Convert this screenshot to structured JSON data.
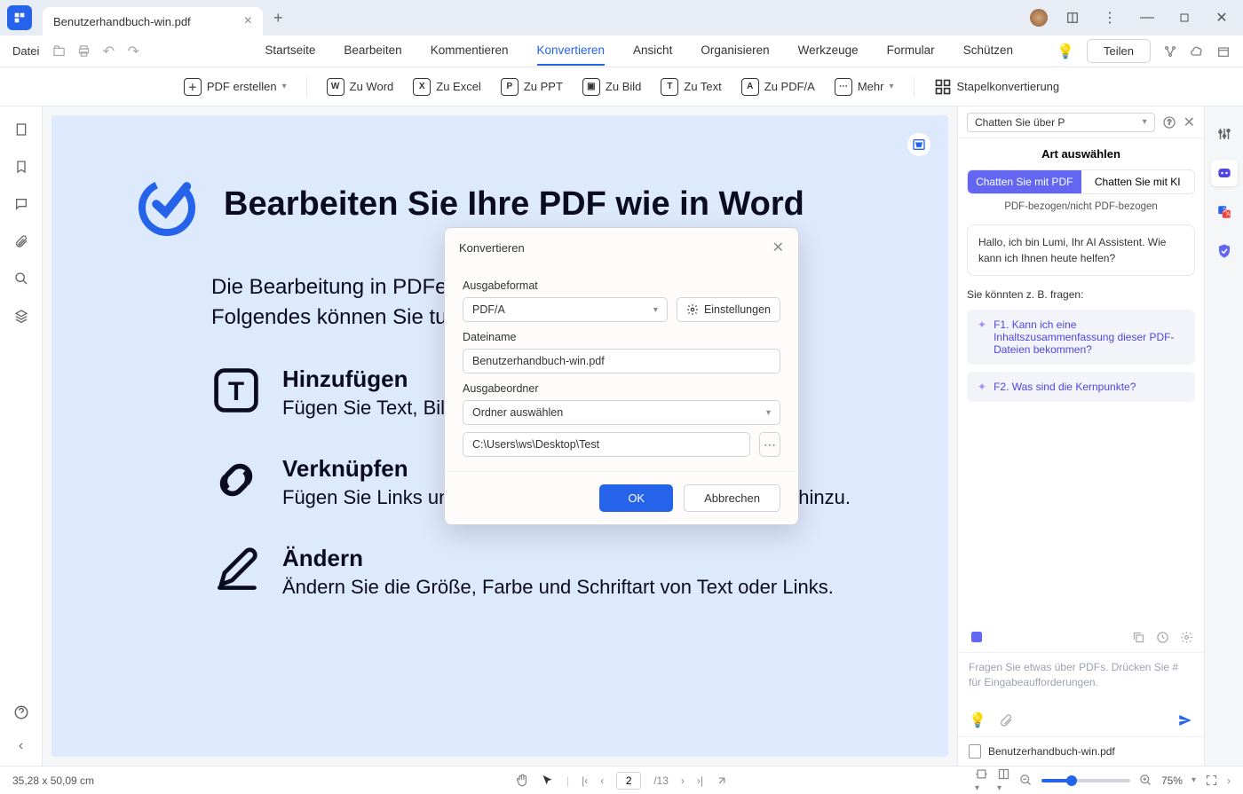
{
  "tab": {
    "title": "Benutzerhandbuch-win.pdf"
  },
  "menu": {
    "file": "Datei",
    "items": [
      "Startseite",
      "Bearbeiten",
      "Kommentieren",
      "Konvertieren",
      "Ansicht",
      "Organisieren",
      "Werkzeuge",
      "Formular",
      "Schützen"
    ],
    "active_index": 3,
    "share": "Teilen"
  },
  "toolbar": {
    "create": "PDF erstellen",
    "word": "Zu Word",
    "excel": "Zu Excel",
    "ppt": "Zu PPT",
    "image": "Zu Bild",
    "text": "Zu Text",
    "pdfa": "Zu PDF/A",
    "more": "Mehr",
    "batch": "Stapelkonvertierung"
  },
  "document": {
    "title": "Bearbeiten Sie Ihre PDF wie in Word",
    "intro1": "Die Bearbeitung in PDFele",
    "intro2": "Folgendes können Sie tu",
    "sections": [
      {
        "title": "Hinzufügen",
        "desc": "Fügen Sie Text, Bilder"
      },
      {
        "title": "Verknüpfen",
        "desc": "Fügen Sie Links und Wasserzeichen zu Ihren PDF-Dateien hinzu."
      },
      {
        "title": "Ändern",
        "desc": "Ändern Sie die Größe, Farbe und Schriftart von Text oder Links."
      }
    ]
  },
  "dialog": {
    "title": "Konvertieren",
    "format_label": "Ausgabeformat",
    "format_value": "PDF/A",
    "settings": "Einstellungen",
    "filename_label": "Dateiname",
    "filename_value": "Benutzerhandbuch-win.pdf",
    "folder_label": "Ausgabeordner",
    "folder_select": "Ordner auswählen",
    "folder_path": "C:\\Users\\ws\\Desktop\\Test",
    "ok": "OK",
    "cancel": "Abbrechen"
  },
  "chat": {
    "selector": "Chatten Sie über P",
    "title": "Art auswählen",
    "tab_pdf": "Chatten Sie mit PDF",
    "tab_ai": "Chatten Sie mit KI",
    "subtext": "PDF-bezogen/nicht PDF-bezogen",
    "greeting": "Hallo, ich bin Lumi, Ihr AI Assistent. Wie kann ich Ihnen heute helfen?",
    "suggest_title": "Sie könnten z. B. fragen:",
    "suggestions": [
      "F1. Kann ich eine Inhaltszusammenfassung dieser PDF-Dateien bekommen?",
      "F2. Was sind die Kernpunkte?"
    ],
    "placeholder": "Fragen Sie etwas über PDFs. Drücken Sie # für Eingabeaufforderungen.",
    "file": "Benutzerhandbuch-win.pdf"
  },
  "status": {
    "dimensions": "35,28 x 50,09 cm",
    "page": "2",
    "total_pages": "/13",
    "zoom": "75%"
  }
}
